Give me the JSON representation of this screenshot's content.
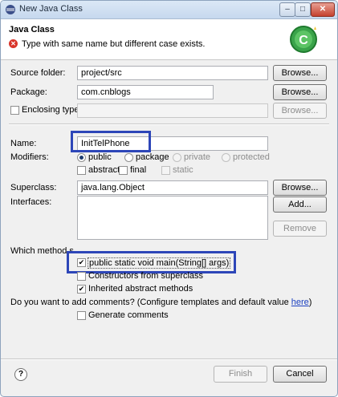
{
  "window": {
    "title": "New Java Class"
  },
  "header": {
    "title": "Java Class",
    "message": "Type with same name but different case exists.",
    "error_icon": "error-icon",
    "logo_icon": "java-class-wizard-icon"
  },
  "fields": {
    "source_folder": {
      "label": "Source folder:",
      "value": "project/src",
      "button": "Browse..."
    },
    "package": {
      "label": "Package:",
      "value": "com.cnblogs",
      "button": "Browse..."
    },
    "enclosing_type": {
      "label": "Enclosing type:",
      "value": "",
      "button": "Browse..."
    },
    "name": {
      "label": "Name:",
      "value": "InitTelPhone"
    },
    "superclass": {
      "label": "Superclass:",
      "value": "java.lang.Object",
      "button": "Browse..."
    },
    "interfaces": {
      "label": "Interfaces:",
      "add_button": "Add...",
      "remove_button": "Remove"
    }
  },
  "modifiers": {
    "label": "Modifiers:",
    "public": "public",
    "package": "package",
    "private": "private",
    "protected": "protected",
    "abstract": "abstract",
    "final": "final",
    "static": "static",
    "selected": "public"
  },
  "stubs": {
    "question": "Which method stubs would you like to create?",
    "question_visible": "Which method s",
    "main": {
      "label": "public static void main(String[] args)",
      "checked": true
    },
    "constructors": {
      "label": "Constructors from superclass",
      "checked": false
    },
    "inherited": {
      "label": "Inherited abstract methods",
      "checked": true
    }
  },
  "comments": {
    "question": "Do you want to add comments? (Configure templates and default value ",
    "link": "here",
    "suffix": ")",
    "generate": {
      "label": "Generate comments",
      "checked": false
    }
  },
  "footer": {
    "finish": "Finish",
    "cancel": "Cancel",
    "help_icon": "help-icon"
  },
  "colors": {
    "highlight": "#2d46b8",
    "link": "#1a3fbf",
    "error": "#d9352a"
  }
}
